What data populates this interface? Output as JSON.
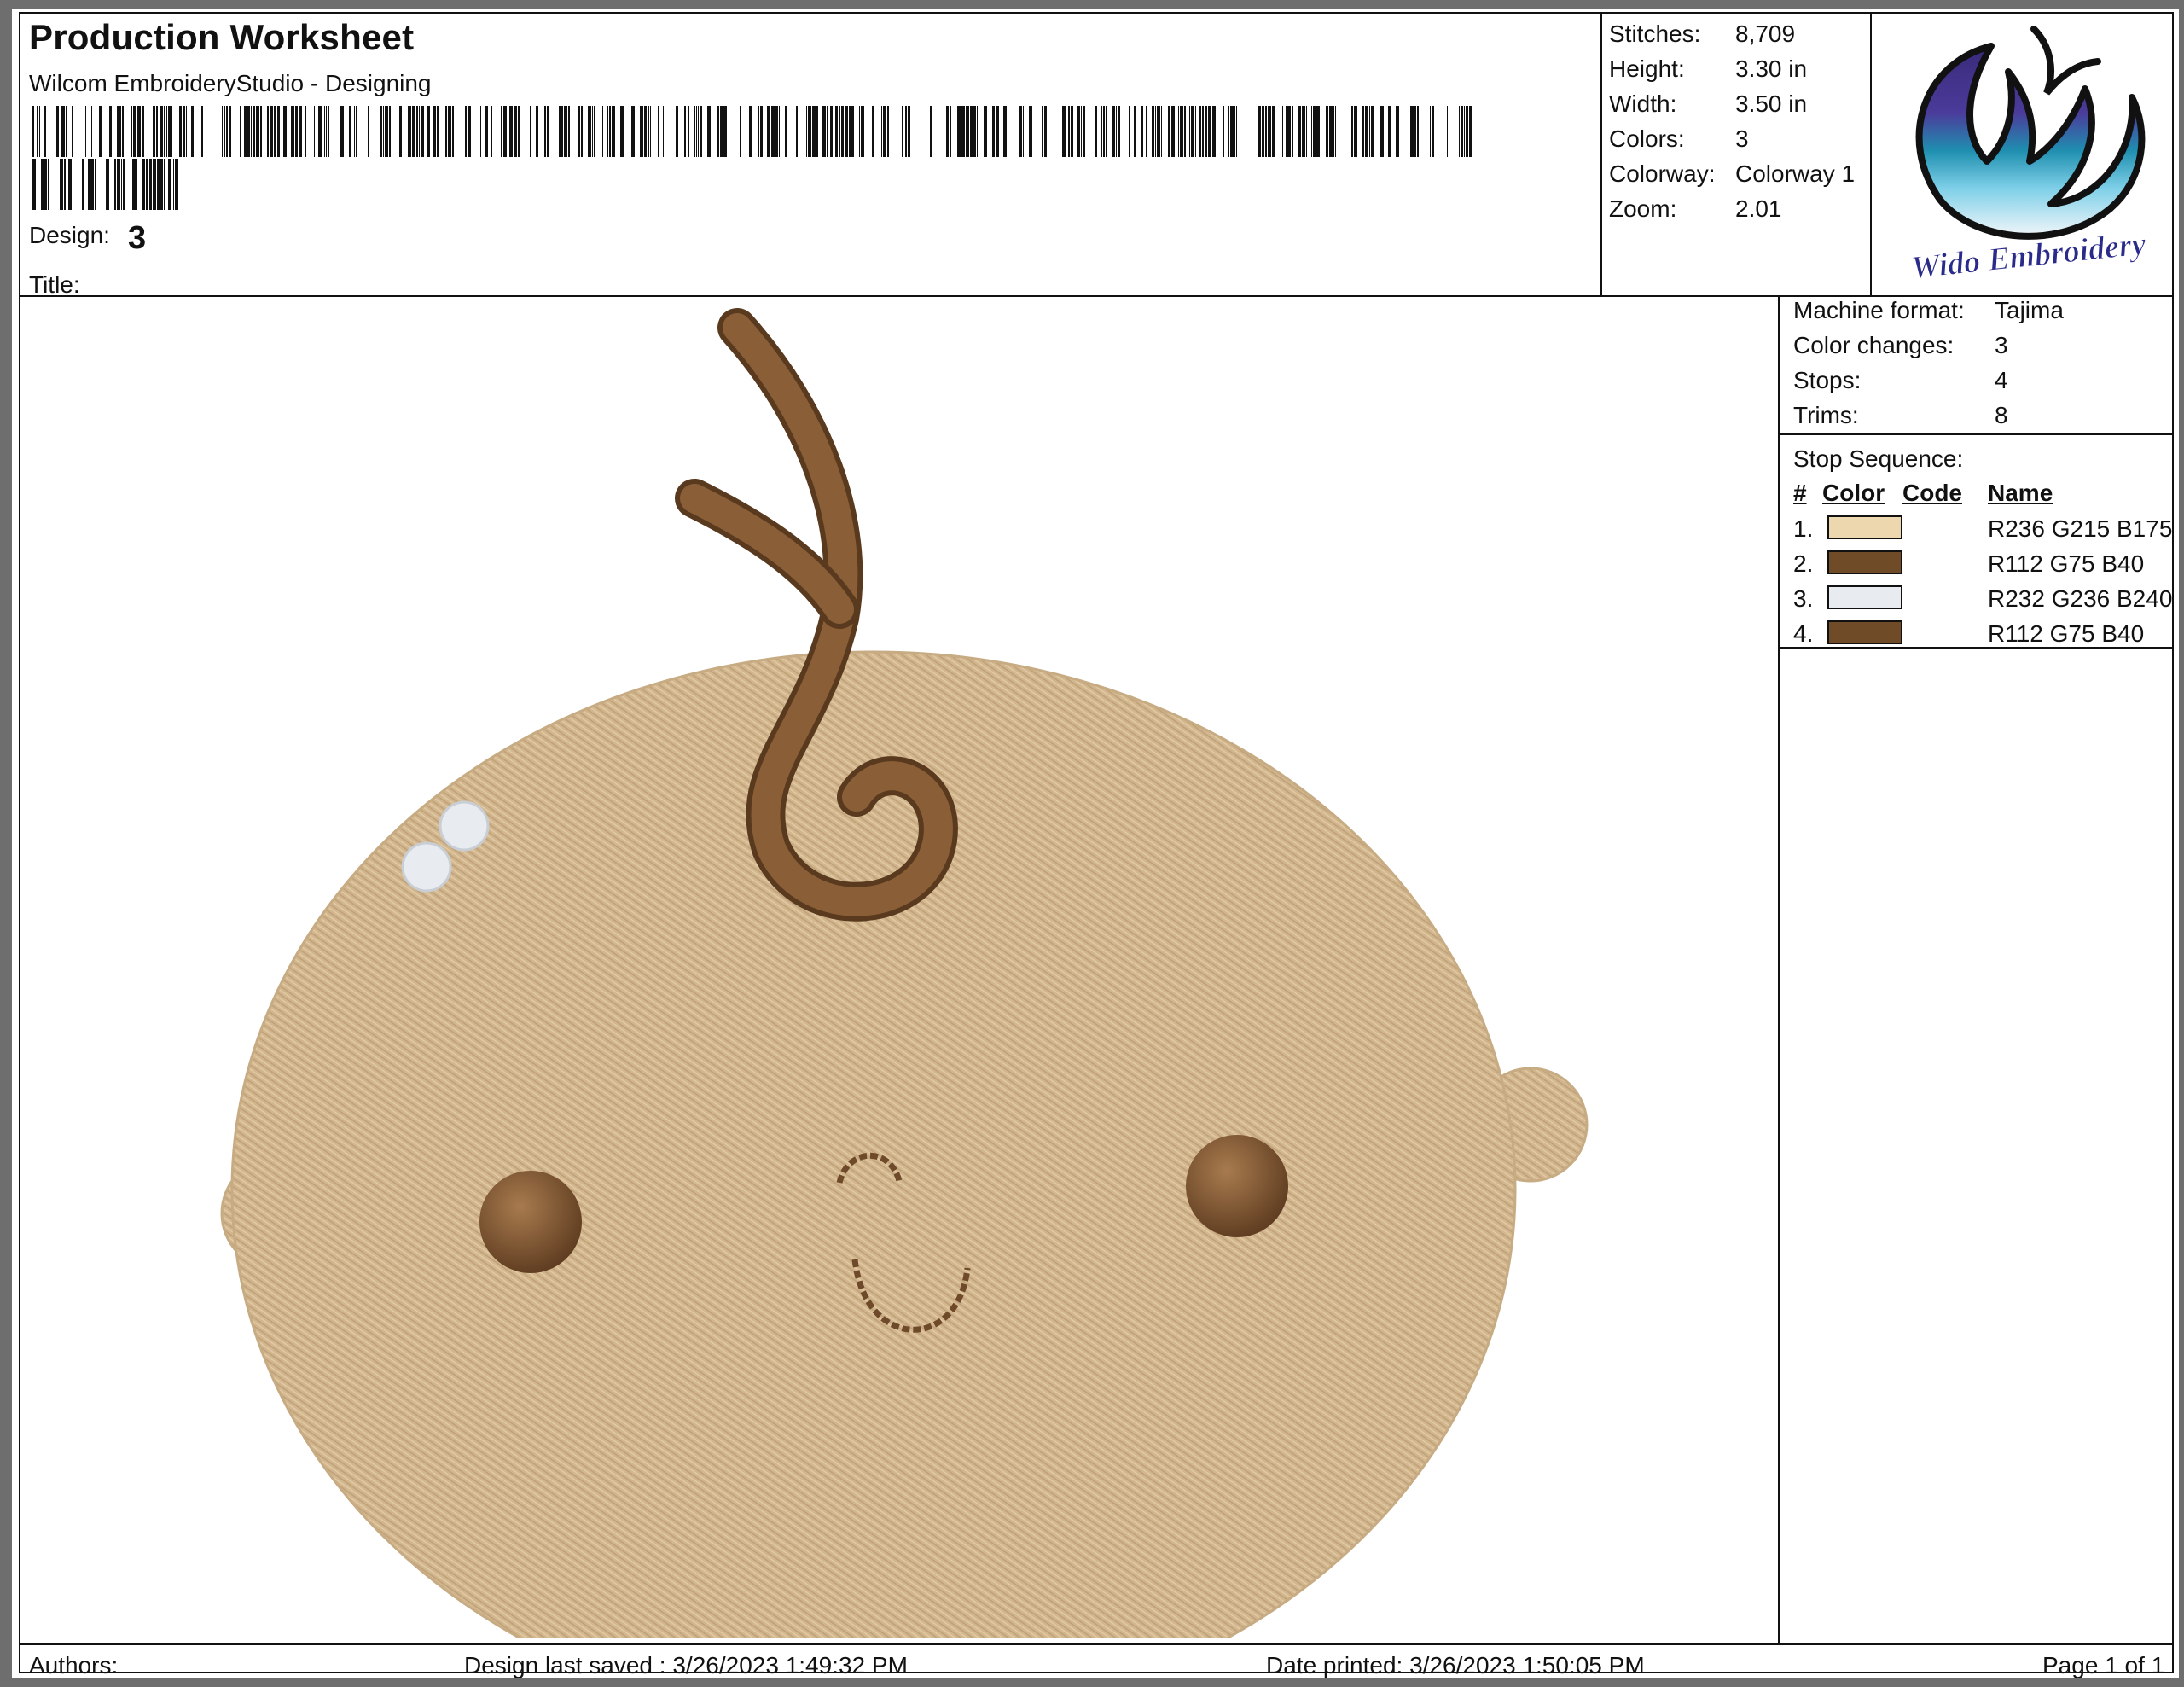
{
  "header": {
    "title": "Production Worksheet",
    "subtitle": "Wilcom EmbroideryStudio - Designing",
    "design_label": "Design:",
    "design_value": "3",
    "title_label": "Title:"
  },
  "stats": [
    {
      "label": "Stitches:",
      "value": "8,709"
    },
    {
      "label": "Height:",
      "value": "3.30 in"
    },
    {
      "label": "Width:",
      "value": "3.50 in"
    },
    {
      "label": "Colors:",
      "value": "3"
    },
    {
      "label": "Colorway:",
      "value": "Colorway 1"
    },
    {
      "label": "Zoom:",
      "value": "2.01"
    }
  ],
  "logo": {
    "text": "Wido Embroidery"
  },
  "machine": [
    {
      "label": "Machine format:",
      "value": "Tajima"
    },
    {
      "label": "Color changes:",
      "value": "3"
    },
    {
      "label": "Stops:",
      "value": "4"
    },
    {
      "label": "Trims:",
      "value": "8"
    }
  ],
  "stop_sequence": {
    "title": "Stop Sequence:",
    "columns": [
      "#",
      "Color",
      "Code",
      "Name"
    ],
    "rows": [
      {
        "num": "1.",
        "color": "#ECD7AF",
        "code": "",
        "name": "R236 G215 B175"
      },
      {
        "num": "2.",
        "color": "#704B28",
        "code": "",
        "name": "R112 G75 B40"
      },
      {
        "num": "3.",
        "color": "#E8ECF0",
        "code": "",
        "name": "R232 G236 B240"
      },
      {
        "num": "4.",
        "color": "#704B28",
        "code": "",
        "name": "R112 G75 B40"
      }
    ]
  },
  "footer": {
    "authors": "Authors:",
    "saved": "Design last saved : 3/26/2023 1:49:32 PM",
    "printed": "Date printed: 3/26/2023 1:50:05 PM",
    "page": "Page 1 of 1"
  },
  "colors": {
    "skin": "#D2B68E",
    "hair": "#7A5330",
    "eyes": "#6E4A2A",
    "highlight": "#E8ECF0"
  }
}
